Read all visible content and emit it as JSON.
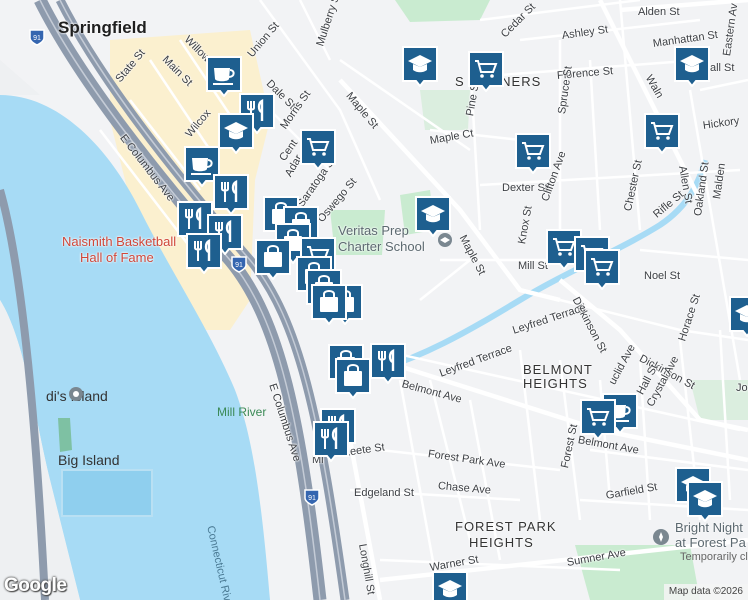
{
  "map": {
    "city": "Springfield",
    "places": {
      "naismith": "Naismith Basketball Hall of Fame",
      "naismith_line1": "Naismith Basketball",
      "naismith_line2": "Hall of Fame",
      "veritas_line1": "Veritas Prep",
      "veritas_line2": "Charter School",
      "bright_line1": "Bright Night",
      "bright_line2": "at Forest Pa",
      "bright_sub": "Temporarily cl",
      "island1": "di's Island",
      "island2": "Big Island",
      "mill_river": "Mill River",
      "connecticut_river": "Connecticut River"
    },
    "areas": {
      "belmont_1": "BELMONT",
      "belmont_2": "HEIGHTS",
      "forest_1": "FOREST PARK",
      "forest_2": "HEIGHTS",
      "corners": "S CORNERS"
    },
    "streets": {
      "alden": "Alden St",
      "eastern": "Eastern Av",
      "ashley": "Ashley St",
      "cedar": "Cedar St",
      "manhattan": "Manhattan St",
      "florence": "Florence St",
      "walnut": "Waln",
      "hall_top": "all St",
      "hickory": "Hickory",
      "mulberry": "Mulberry St",
      "maple": "Maple St",
      "maple_ct": "Maple Ct",
      "maple2": "Maple St",
      "pine": "Pine St",
      "spruce": "Spruce St",
      "allen": "Allen St",
      "malden": "Malden",
      "oakland": "Oakland St",
      "dexter": "Dexter St",
      "clifton": "Clifton Ave",
      "chester": "Chester St",
      "rifle": "Rifle St",
      "knox": "Knox St",
      "mill": "Mill St",
      "noel": "Noel St",
      "dickinson": "Dickinson St",
      "dickinson2": "Dickinson St",
      "leyfred1": "Leyfred Terrace",
      "leyfred2": "Leyfred Terrace",
      "horace": "Horace St",
      "belmont_ave": "Belmont Ave",
      "belmont_ave2": "Belmont Ave",
      "crystal": "Crystal Ave",
      "hall": "Hall St",
      "euclid": "uclid Ave",
      "forest_st": "Forest St",
      "forest_park_ave": "Forest Park Ave",
      "chase": "Chase Ave",
      "garfield": "Garfield St",
      "leete": "Leete St",
      "edgeland": "Edgeland St",
      "longhill": "Longhill St",
      "warner": "Warner St",
      "sumner": "Sumner Ave",
      "willow": "Willow St",
      "union": "Union St",
      "main": "Main St",
      "state": "State St",
      "dale": "Dale St",
      "morris": "Morris St",
      "wilcox": "Wilcox",
      "e_columbus": "E Columbus Ave",
      "e_columbus2": "E Columbus Ave",
      "adams": "Adar",
      "saratoga": "Saratoga St",
      "oswego": "Oswego St",
      "mi": "Mi",
      "cent": "Cent",
      "jo": "Jo",
      "interstate": "91"
    },
    "pins": [
      {
        "kind": "shopping-cart",
        "label": "Grocery store"
      },
      {
        "kind": "school",
        "label": "School"
      },
      {
        "kind": "restaurant",
        "label": "Restaurant"
      },
      {
        "kind": "shopping-bag",
        "label": "Store"
      },
      {
        "kind": "cafe",
        "label": "Cafe"
      }
    ],
    "attribution": "Map data ©2026",
    "google_logo": "Google",
    "colors": {
      "water": "#a7dbf5",
      "park": "#c9ebd0",
      "highway": "#8e9bad",
      "pin": "#1e5f8f",
      "downtown": "#fbf0cf"
    }
  }
}
